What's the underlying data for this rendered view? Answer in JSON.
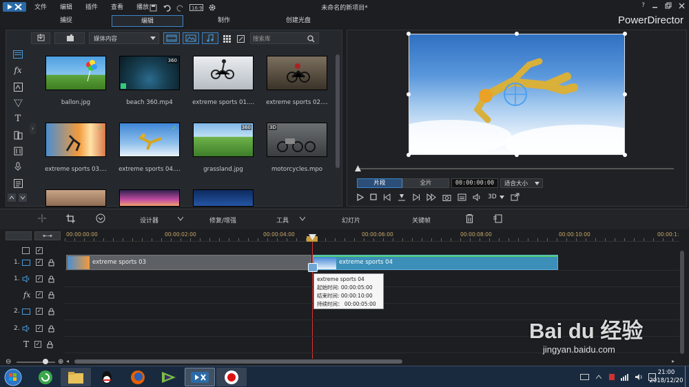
{
  "app": {
    "title": "未命名的新项目*",
    "brand": "PowerDirector",
    "menu": [
      "文件",
      "编辑",
      "插件",
      "查看",
      "播放"
    ]
  },
  "modes": [
    "捕捉",
    "编辑",
    "制作",
    "创建光盘"
  ],
  "library": {
    "dropdown": "媒体内容",
    "search_placeholder": "搜索库",
    "items": [
      {
        "label": "ballon.jpg",
        "badge": ""
      },
      {
        "label": "beach 360.mp4",
        "badge": "360"
      },
      {
        "label": "extreme sports 01....",
        "badge": ""
      },
      {
        "label": "extreme sports 02....",
        "badge": ""
      },
      {
        "label": "extreme sports 03....",
        "badge": "✓"
      },
      {
        "label": "extreme sports 04....",
        "badge": "✓"
      },
      {
        "label": "grassland.jpg",
        "badge": "360"
      },
      {
        "label": "motorcycles.mpo",
        "badge": "3D"
      }
    ]
  },
  "preview": {
    "btn_clip": "片段",
    "btn_full": "全片",
    "timecode": "00:00:00:00",
    "fit": "适合大小",
    "label_3d": "3D"
  },
  "toolbar": {
    "designer": "设计器",
    "fix": "修复/增强",
    "tools": "工具",
    "slideshow": "幻灯片",
    "keyframe": "关键帧"
  },
  "ruler": [
    "00:00:00:00",
    "00:00:02:00",
    "00:00:04:00",
    "00:00:06:00",
    "00:00:08:00",
    "00:00:10:00",
    "00:00:1:"
  ],
  "tracks": [
    "1.",
    "1.",
    "",
    "2.",
    "2.",
    ""
  ],
  "clips": {
    "clip1": "extreme sports 03",
    "clip2": "extreme sports 04"
  },
  "tooltip": {
    "title": "extreme sports 04",
    "start": "起始时间: 00:00:05:00",
    "end": "结束时间: 00:00:10:00",
    "dur": "持续时间： 00:00:05:00"
  },
  "taskbar": {
    "time": "21:00",
    "date": "2018/12/20"
  },
  "watermark": {
    "logo": "Bai du 经验",
    "url": "jingyan.baidu.com"
  },
  "colors": {
    "accent": "#3d84c9",
    "clip_selected": "#3b8fb8",
    "playhead": "#d33"
  }
}
